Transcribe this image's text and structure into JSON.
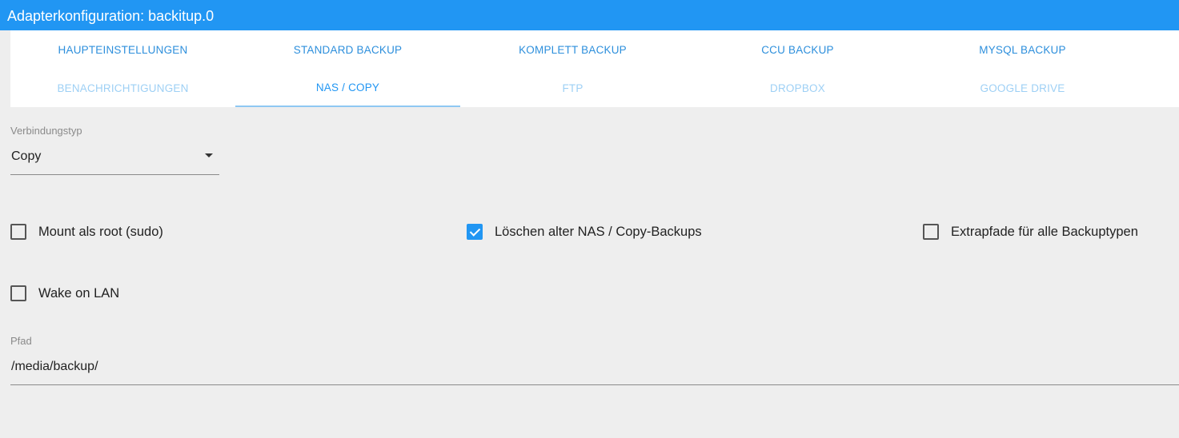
{
  "window": {
    "title": "Adapterkonfiguration: backitup.0"
  },
  "tabs": {
    "row1": [
      "HAUPTEINSTELLUNGEN",
      "STANDARD BACKUP",
      "KOMPLETT BACKUP",
      "CCU BACKUP",
      "MYSQL BACKUP"
    ],
    "row2": [
      "BENACHRICHTIGUNGEN",
      "NAS / COPY",
      "FTP",
      "DROPBOX",
      "GOOGLE DRIVE"
    ],
    "active": "NAS / COPY"
  },
  "connection_type": {
    "label": "Verbindungstyp",
    "value": "Copy"
  },
  "options": {
    "mount_root": {
      "label": "Mount als root (sudo)",
      "checked": false
    },
    "delete_old": {
      "label": "Löschen alter NAS / Copy-Backups",
      "checked": true
    },
    "extra_paths": {
      "label": "Extrapfade für alle Backuptypen",
      "checked": false
    },
    "wake_on_lan": {
      "label": "Wake on LAN",
      "checked": false
    }
  },
  "path": {
    "label": "Pfad",
    "value": "/media/backup/"
  },
  "colors": {
    "accent": "#2196f3",
    "background": "#eeeeee",
    "tab_inactive": "#9ed0f5"
  }
}
